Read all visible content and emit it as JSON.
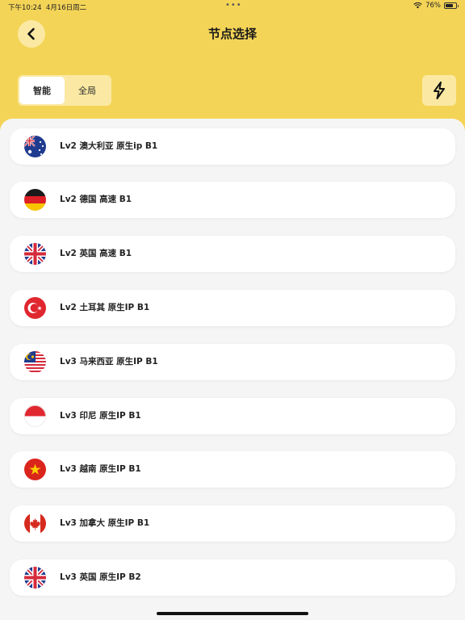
{
  "status_bar": {
    "time": "下午10:24",
    "date": "4月16日周二",
    "battery_text": "76%",
    "battery_level": 0.76
  },
  "header": {
    "title": "节点选择",
    "back_icon": "chevron-left-icon",
    "background_color": "#f4d457"
  },
  "mode_tabs": [
    {
      "label": "智能",
      "active": true
    },
    {
      "label": "全局",
      "active": false
    }
  ],
  "flash_button_icon": "lightning-icon",
  "nodes": [
    {
      "label": "Lv2 澳大利亚 原生ip B1",
      "flag": "australia-flag-icon"
    },
    {
      "label": "Lv2 德国 高速 B1",
      "flag": "germany-flag-icon"
    },
    {
      "label": "Lv2 英国 高速 B1",
      "flag": "uk-flag-icon"
    },
    {
      "label": "Lv2 土耳其 原生IP B1",
      "flag": "turkey-flag-icon"
    },
    {
      "label": "Lv3 马来西亚 原生IP B1",
      "flag": "malaysia-flag-icon"
    },
    {
      "label": "Lv3 印尼 原生IP B1",
      "flag": "indonesia-flag-icon"
    },
    {
      "label": "Lv3 越南 原生IP B1",
      "flag": "vietnam-flag-icon"
    },
    {
      "label": "Lv3 加拿大 原生IP B1",
      "flag": "canada-flag-icon"
    },
    {
      "label": "Lv3 英国 原生IP B2",
      "flag": "uk-flag-icon"
    }
  ]
}
